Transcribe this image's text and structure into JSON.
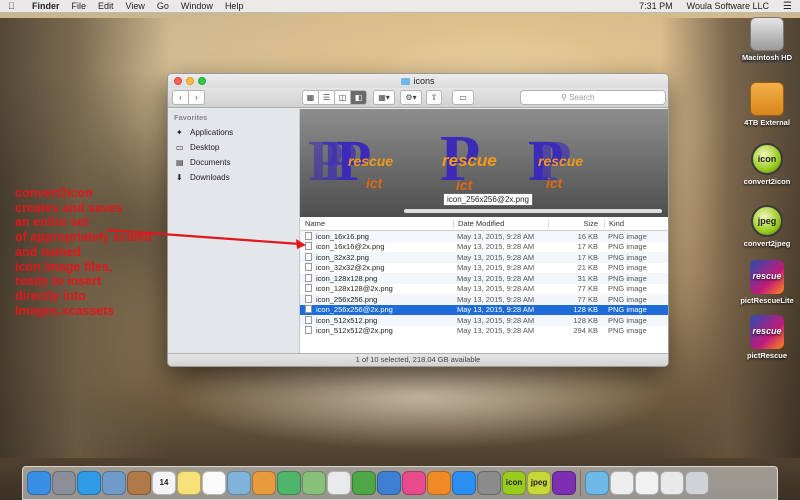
{
  "menubar": {
    "app": "Finder",
    "menus": [
      "File",
      "Edit",
      "View",
      "Go",
      "Window",
      "Help"
    ],
    "time": "7:31 PM",
    "user": "Woula Software LLC"
  },
  "desktop_icons": [
    {
      "label": "Macintosh HD",
      "icon": "hard-drive-icon"
    },
    {
      "label": "4TB External",
      "icon": "external-drive-icon"
    },
    {
      "label": "convert2icon",
      "icon": "icon-app-icon",
      "badge": "icon"
    },
    {
      "label": "convert2jpeg",
      "icon": "jpeg-app-icon",
      "badge": "jpeg"
    },
    {
      "label": "pictRescueLite",
      "icon": "pictrescue-lite-icon",
      "badge": "rescue"
    },
    {
      "label": "pictRescue",
      "icon": "pictrescue-icon",
      "badge": "rescue"
    }
  ],
  "window": {
    "title": "icons",
    "search_placeholder": "Search",
    "sidebar": {
      "heading": "Favorites",
      "items": [
        "Applications",
        "Desktop",
        "Documents",
        "Downloads"
      ]
    },
    "coverflow": {
      "tooltip": "icon_256x256@2x.png",
      "art_texts": [
        "rescue",
        "ict",
        "P"
      ]
    },
    "columns": {
      "name": "Name",
      "date": "Date Modified",
      "size": "Size",
      "kind": "Kind"
    },
    "files": [
      {
        "name": "icon_16x16.png",
        "date": "May 13, 2015, 9:28 AM",
        "size": "16 KB",
        "kind": "PNG image"
      },
      {
        "name": "icon_16x16@2x.png",
        "date": "May 13, 2015, 9:28 AM",
        "size": "17 KB",
        "kind": "PNG image"
      },
      {
        "name": "icon_32x32.png",
        "date": "May 13, 2015, 9:28 AM",
        "size": "17 KB",
        "kind": "PNG image"
      },
      {
        "name": "icon_32x32@2x.png",
        "date": "May 13, 2015, 9:28 AM",
        "size": "21 KB",
        "kind": "PNG image"
      },
      {
        "name": "icon_128x128.png",
        "date": "May 13, 2015, 9:28 AM",
        "size": "31 KB",
        "kind": "PNG image"
      },
      {
        "name": "icon_128x128@2x.png",
        "date": "May 13, 2015, 9:28 AM",
        "size": "77 KB",
        "kind": "PNG image"
      },
      {
        "name": "icon_256x256.png",
        "date": "May 13, 2015, 9:28 AM",
        "size": "77 KB",
        "kind": "PNG image"
      },
      {
        "name": "icon_256x256@2x.png",
        "date": "May 13, 2015, 9:28 AM",
        "size": "128 KB",
        "kind": "PNG image",
        "selected": true
      },
      {
        "name": "icon_512x512.png",
        "date": "May 13, 2015, 9:28 AM",
        "size": "128 KB",
        "kind": "PNG image"
      },
      {
        "name": "icon_512x512@2x.png",
        "date": "May 13, 2015, 9:28 AM",
        "size": "294 KB",
        "kind": "PNG image"
      }
    ],
    "status": "1 of 10 selected, 218.04 GB available"
  },
  "annotation": {
    "lines": [
      "convert2icon",
      "creates and saves",
      "an entire set",
      "of appropriately scaled",
      "and named",
      "icon image files,",
      "ready to insert",
      "directly into",
      "Images.xcassets"
    ],
    "color": "#e3161b"
  },
  "dock": {
    "items": [
      {
        "icon": "finder-icon",
        "color": "#3a8ee6"
      },
      {
        "icon": "launchpad-icon",
        "color": "#8a8f99"
      },
      {
        "icon": "safari-icon",
        "color": "#2f9be6"
      },
      {
        "icon": "preview-icon",
        "color": "#6f9bc9"
      },
      {
        "icon": "contacts-icon",
        "color": "#b07a48"
      },
      {
        "icon": "calendar-icon",
        "color": "#f4f4f4",
        "text": "14"
      },
      {
        "icon": "notes-icon",
        "color": "#f7e27a"
      },
      {
        "icon": "reminders-icon",
        "color": "#fafafa"
      },
      {
        "icon": "preview-photos-icon",
        "color": "#7fb4d8"
      },
      {
        "icon": "photos-icon",
        "color": "#e79a3e"
      },
      {
        "icon": "facetime-icon",
        "color": "#4fb56a"
      },
      {
        "icon": "maps-icon",
        "color": "#88c07a"
      },
      {
        "icon": "textedit-icon",
        "color": "#eaeaea"
      },
      {
        "icon": "numbers-icon",
        "color": "#4ea646"
      },
      {
        "icon": "keynote-icon",
        "color": "#3f7fd1"
      },
      {
        "icon": "itunes-icon",
        "color": "#e84a8c"
      },
      {
        "icon": "ibooks-icon",
        "color": "#f08a24"
      },
      {
        "icon": "app-store-icon",
        "color": "#2c8ef0"
      },
      {
        "icon": "system-preferences-icon",
        "color": "#8b8b8b"
      },
      {
        "icon": "convert2icon-dock-icon",
        "color": "#9acb1f",
        "text": "icon"
      },
      {
        "icon": "convert2jpeg-dock-icon",
        "color": "#c7d93a",
        "text": "jpeg"
      },
      {
        "icon": "pictrescue-dock-icon",
        "color": "#7c2fb0"
      },
      {
        "icon": "applications-folder-icon",
        "color": "#6eb8e8"
      },
      {
        "icon": "document-icon",
        "color": "#eeeeee"
      },
      {
        "icon": "document-2-icon",
        "color": "#f2f2f2"
      },
      {
        "icon": "document-3-icon",
        "color": "#e9e9e9"
      },
      {
        "icon": "trash-icon",
        "color": "#cfd3d6"
      }
    ]
  }
}
